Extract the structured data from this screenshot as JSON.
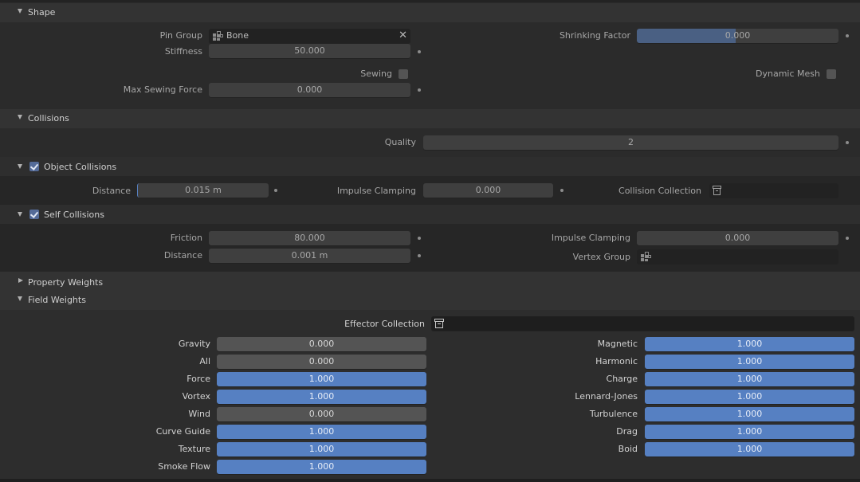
{
  "shape": {
    "title": "Shape",
    "pin_group_label": "Pin Group",
    "pin_group_value": "Bone",
    "stiffness_label": "Stiffness",
    "stiffness_value": "50.000",
    "sewing_label": "Sewing",
    "sewing_checked": false,
    "max_sewing_force_label": "Max Sewing Force",
    "max_sewing_force_value": "0.000",
    "shrinking_factor_label": "Shrinking Factor",
    "shrinking_factor_value": "0.000",
    "shrinking_factor_fill_fraction": 0.5,
    "dynamic_mesh_label": "Dynamic Mesh",
    "dynamic_mesh_checked": false
  },
  "collisions": {
    "title": "Collisions",
    "quality_label": "Quality",
    "quality_value": "2",
    "object_collisions": {
      "title": "Object Collisions",
      "checked": true,
      "distance_label": "Distance",
      "distance_value": "0.015 m",
      "impulse_clamping_label": "Impulse Clamping",
      "impulse_clamping_value": "0.000",
      "collision_collection_label": "Collision Collection",
      "collision_collection_value": ""
    },
    "self_collisions": {
      "title": "Self Collisions",
      "checked": true,
      "friction_label": "Friction",
      "friction_value": "80.000",
      "distance_label": "Distance",
      "distance_value": "0.001 m",
      "impulse_clamping_label": "Impulse Clamping",
      "impulse_clamping_value": "0.000",
      "vertex_group_label": "Vertex Group",
      "vertex_group_value": ""
    }
  },
  "property_weights": {
    "title": "Property Weights",
    "expanded": false
  },
  "field_weights": {
    "title": "Field Weights",
    "effector_collection_label": "Effector Collection",
    "effector_collection_value": "",
    "left": [
      {
        "label": "Gravity",
        "value": "0.000"
      },
      {
        "label": "All",
        "value": "0.000"
      },
      {
        "label": "Force",
        "value": "1.000"
      },
      {
        "label": "Vortex",
        "value": "1.000"
      },
      {
        "label": "Wind",
        "value": "0.000"
      },
      {
        "label": "Curve Guide",
        "value": "1.000"
      },
      {
        "label": "Texture",
        "value": "1.000"
      },
      {
        "label": "Smoke Flow",
        "value": "1.000"
      }
    ],
    "right": [
      {
        "label": "Magnetic",
        "value": "1.000"
      },
      {
        "label": "Harmonic",
        "value": "1.000"
      },
      {
        "label": "Charge",
        "value": "1.000"
      },
      {
        "label": "Lennard-Jones",
        "value": "1.000"
      },
      {
        "label": "Turbulence",
        "value": "1.000"
      },
      {
        "label": "Drag",
        "value": "1.000"
      },
      {
        "label": "Boid",
        "value": "1.000"
      }
    ]
  },
  "colors": {
    "accent_blue": "#5680c2",
    "slider_fill": "#4a6083",
    "checkbox_blue": "#546b98"
  }
}
